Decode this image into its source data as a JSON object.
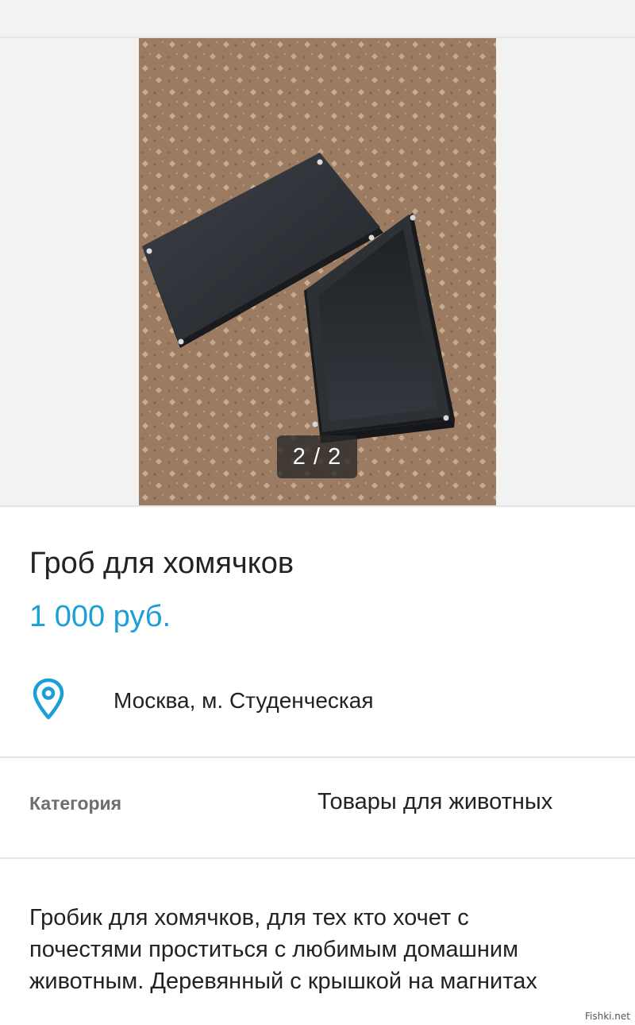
{
  "gallery": {
    "counter": "2 / 2",
    "photo_subject": "black wooden box with lid on carpet"
  },
  "listing": {
    "title": "Гроб для хомячков",
    "price": "1 000 руб.",
    "location": "Москва, м. Студенческая"
  },
  "details": {
    "category_label": "Категория",
    "category_value": "Товары для животных"
  },
  "description": {
    "lines": [
      "Гробик для хомячков, для тех кто хочет с",
      "почестями проститься с любимым домашним",
      "животным. Деревянный с крышкой на магнитах"
    ]
  },
  "watermark": "Fishki.net",
  "colors": {
    "accent": "#1c9fd6",
    "text": "#222222",
    "muted": "#6e6e6e",
    "divider": "#e3e3e3"
  },
  "icons": {
    "location": "location-pin-icon"
  }
}
